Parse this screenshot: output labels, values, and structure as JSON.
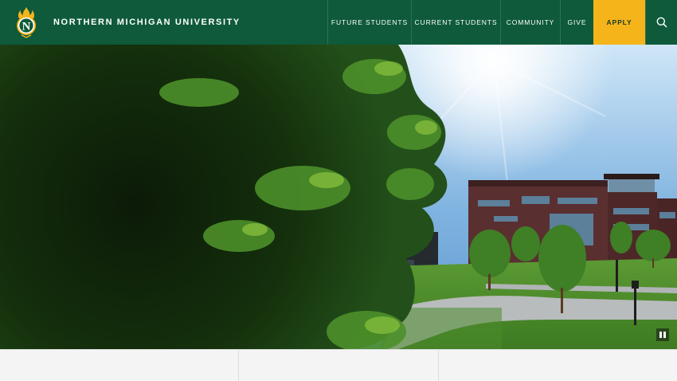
{
  "header": {
    "university_name": "NORTHERN MICHIGAN UNIVERSITY",
    "logo_letter": "N",
    "colors": {
      "background": "#0e5a3a",
      "accent": "#f4b41a"
    }
  },
  "nav": {
    "future_students": "FUTURE STUDENTS",
    "current_students": "CURRENT STUDENTS",
    "community": "COMMUNITY",
    "give": "GIVE",
    "apply": "APPLY",
    "search_icon": "search-icon"
  },
  "hero": {
    "video_control_icon": "pause-icon"
  }
}
